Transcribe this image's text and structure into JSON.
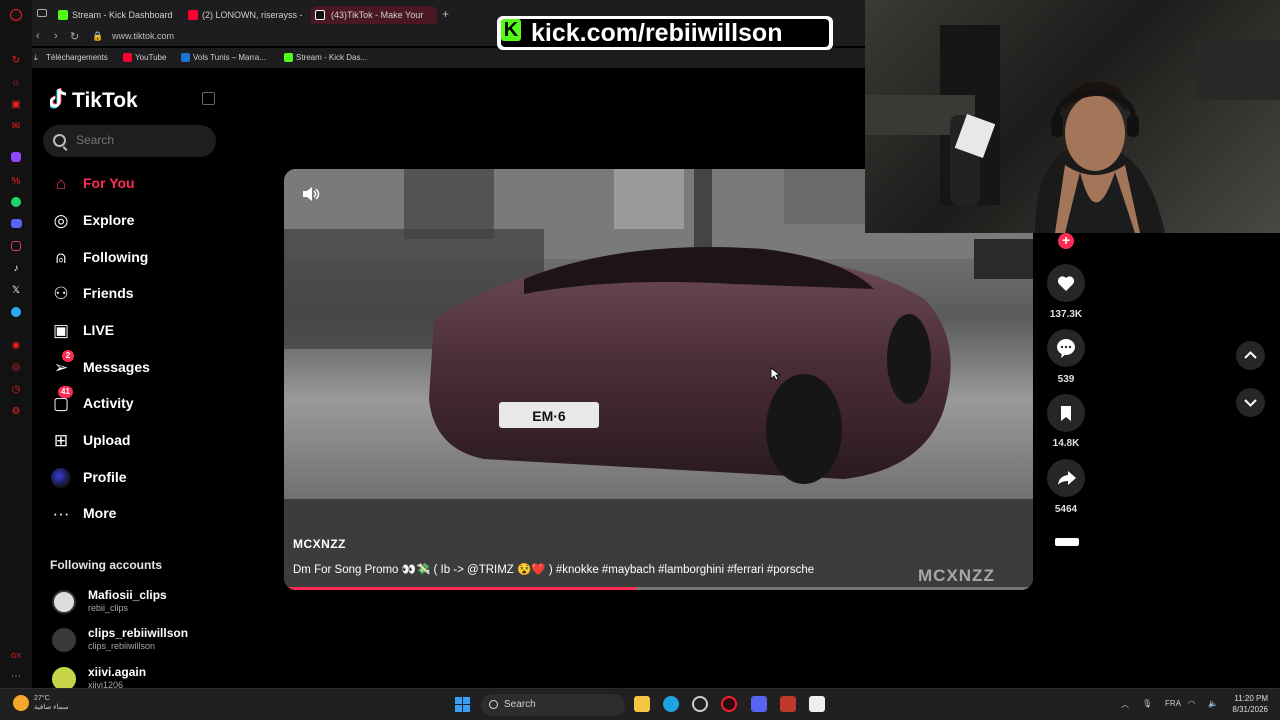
{
  "browser": {
    "tabs": [
      {
        "label": "Stream - Kick Dashboard",
        "icon": "kick-icon",
        "color": "#53fc18"
      },
      {
        "label": "(2) LONOWN, riserayss - v",
        "icon": "youtube-icon",
        "color": "#ff0033"
      },
      {
        "label": "(43)TikTok - Make Your",
        "icon": "tiktok-icon",
        "color": "#111111",
        "active": true
      }
    ],
    "url": "www.tiktok.com",
    "bookmarks": [
      {
        "label": "Téléchargements",
        "icon": "download-icon"
      },
      {
        "label": "YouTube",
        "icon": "youtube-icon"
      },
      {
        "label": "Vols Tunis – Marra...",
        "icon": "plane-icon"
      },
      {
        "label": "Stream - Kick Das...",
        "icon": "kick-icon"
      }
    ]
  },
  "overlay": {
    "kick_url": "kick.com/rebiiwillson",
    "kick_k": "K"
  },
  "tiktok": {
    "logo": "TikTok",
    "search_placeholder": "Search",
    "nav": [
      {
        "label": "For You",
        "icon": "home-icon",
        "active": true
      },
      {
        "label": "Explore",
        "icon": "compass-icon"
      },
      {
        "label": "Following",
        "icon": "following-icon"
      },
      {
        "label": "Friends",
        "icon": "friends-icon"
      },
      {
        "label": "LIVE",
        "icon": "live-icon"
      },
      {
        "label": "Messages",
        "icon": "messages-icon",
        "badge": "2"
      },
      {
        "label": "Activity",
        "icon": "activity-icon",
        "badge": "41"
      },
      {
        "label": "Upload",
        "icon": "upload-icon"
      },
      {
        "label": "Profile",
        "icon": "profile-icon"
      },
      {
        "label": "More",
        "icon": "more-icon"
      }
    ],
    "following_title": "Following accounts",
    "following": [
      {
        "name": "Mafiosii_clips",
        "username": "rebii_clips"
      },
      {
        "name": "clips_rebiiwillson",
        "username": "clips_rebiiwillson"
      },
      {
        "name": "xiivi.again",
        "username": "xiivi1206"
      }
    ]
  },
  "video": {
    "creator": "MCXNZZ",
    "caption": "Dm For Song Promo 👀💸 ( Ib -> @TRIMZ 😵❤️ ) #knokke #maybach #lamborghini #ferrari #porsche",
    "watermark": "MCXNZZ",
    "plate": "EM·6",
    "progress": 0.47
  },
  "actions": {
    "likes": "137.3K",
    "comments": "539",
    "saves": "14.8K",
    "shares": "5464"
  },
  "taskbar": {
    "weather_temp": "27°C",
    "weather_desc": "سماء صافية",
    "search_label": "Search",
    "lang": "FRA",
    "time": "11:20 PM",
    "date": "8/31/2026"
  },
  "colors": {
    "accent": "#fe2c55",
    "kick_green": "#53fc18"
  }
}
